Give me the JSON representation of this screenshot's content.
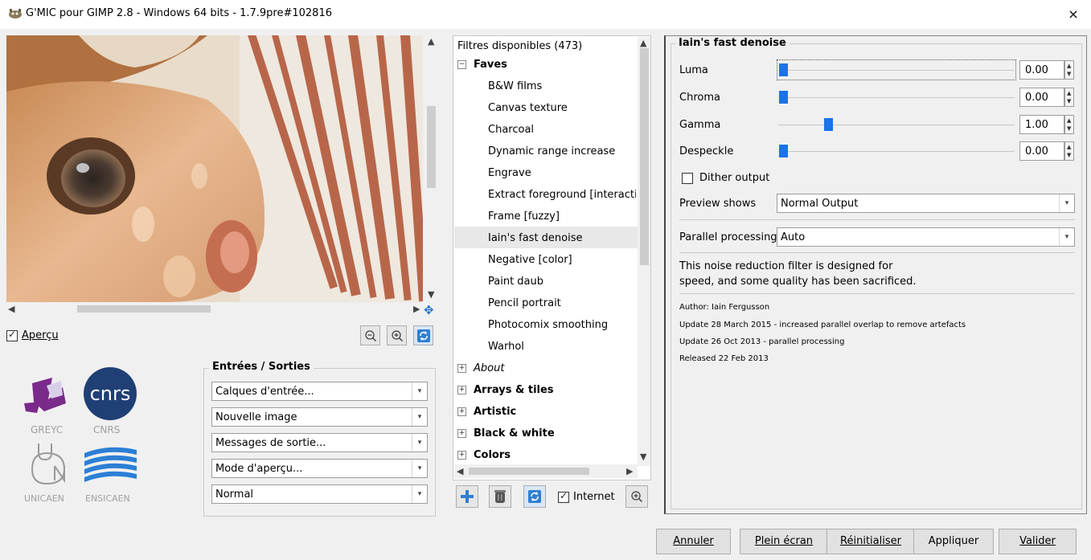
{
  "window": {
    "title": "G'MIC pour GIMP 2.8 - Windows 64 bits - 1.7.9pre#102816",
    "close_glyph": "×"
  },
  "preview": {
    "apercu_label": "Aperçu",
    "apercu_checked": true,
    "zoom_out_icon": "zoom-out-icon",
    "zoom_in_icon": "zoom-in-icon",
    "refresh_icon": "refresh-icon"
  },
  "logos": {
    "greyc": "GREYC",
    "cnrs": "CNRS",
    "cnrs_mark": "cnrs",
    "unicaen": "UNICAEN",
    "ensicaen": "ENSICAEN"
  },
  "io": {
    "title": "Entrées / Sorties",
    "combos": [
      "Calques d'entrée...",
      "Nouvelle image",
      "Messages de sortie...",
      "Mode d'aperçu...",
      "Normal"
    ]
  },
  "filters": {
    "header": "Filtres disponibles (473)",
    "faves_label": "Faves",
    "faves": [
      "B&W films",
      "Canvas texture",
      "Charcoal",
      "Dynamic range increase",
      "Engrave",
      "Extract foreground [interactive",
      "Frame [fuzzy]",
      "Iain's fast denoise",
      "Negative [color]",
      "Paint daub",
      "Pencil portrait",
      "Photocomix smoothing",
      "Warhol"
    ],
    "selected": "Iain's fast denoise",
    "categories": [
      "About",
      "Arrays & tiles",
      "Artistic",
      "Black & white",
      "Colors"
    ],
    "internet_label": "Internet",
    "internet_checked": true
  },
  "params": {
    "title": "Iain's fast denoise",
    "sliders": [
      {
        "label": "Luma",
        "value": "0.00",
        "level": 0.0
      },
      {
        "label": "Chroma",
        "value": "0.00",
        "level": 0.0
      },
      {
        "label": "Gamma",
        "value": "1.00",
        "level": 0.2
      },
      {
        "label": "Despeckle",
        "value": "0.00",
        "level": 0.0
      }
    ],
    "dither_label": "Dither output",
    "dither_checked": false,
    "preview_shows_label": "Preview shows",
    "preview_shows_value": "Normal Output",
    "parallel_label": "Parallel processing",
    "parallel_value": "Auto",
    "description_line1": "This noise reduction filter is designed for",
    "description_line2": "speed, and some quality has been sacrificed.",
    "notes": [
      "Author: Iain Fergusson",
      "Update 28 March 2015 - increased parallel overlap to remove artefacts",
      "Update 26 Oct 2013 - parallel processing",
      "Released 22 Feb 2013"
    ]
  },
  "buttons": {
    "annuler": "Annuler",
    "plein_ecran": "Plein écran",
    "reinitialiser": "Réinitialiser",
    "appliquer": "Appliquer",
    "valider": "Valider"
  }
}
